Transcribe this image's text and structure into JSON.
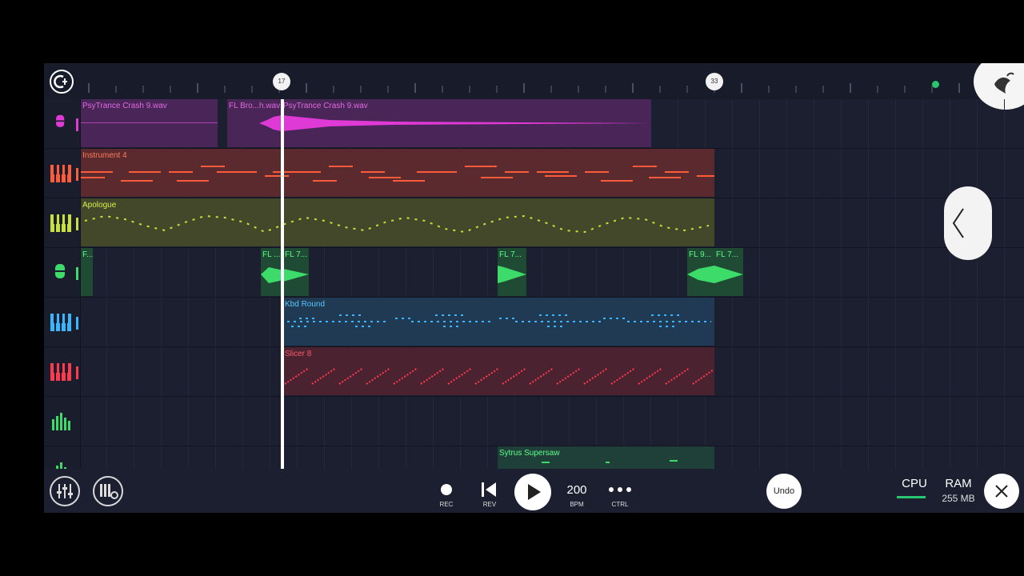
{
  "ruler": {
    "markers": [
      "17",
      "33"
    ]
  },
  "tracks": [
    {
      "id": "t1",
      "icon": "microphone-icon",
      "color": "#e03ad6",
      "clips": [
        {
          "label": "PsyTrance Crash 9.wav"
        },
        {
          "label": "FL Bro...h.wav"
        },
        {
          "label": "PsyTrance Crash 9.wav"
        }
      ]
    },
    {
      "id": "t2",
      "icon": "piano-icon",
      "color": "#ff5a3a",
      "clips": [
        {
          "label": "Instrument 4"
        }
      ]
    },
    {
      "id": "t3",
      "icon": "piano-icon",
      "color": "#c7e03a",
      "clips": [
        {
          "label": "Apologue"
        }
      ]
    },
    {
      "id": "t4",
      "icon": "microphone-icon",
      "color": "#3ddc6a",
      "clips": [
        {
          "label": "F..."
        },
        {
          "label": "FL ..."
        },
        {
          "label": "FL 7..."
        },
        {
          "label": "FL 7..."
        },
        {
          "label": "FL 9..."
        },
        {
          "label": "FL 7..."
        }
      ]
    },
    {
      "id": "t5",
      "icon": "piano-icon",
      "color": "#3ab6ff",
      "clips": [
        {
          "label": "Kbd Round"
        }
      ]
    },
    {
      "id": "t6",
      "icon": "piano-icon",
      "color": "#ff3a4f",
      "clips": [
        {
          "label": "Slicer 8"
        }
      ]
    },
    {
      "id": "t7",
      "icon": "automation-icon",
      "color": "#3ddc6a",
      "clips": []
    },
    {
      "id": "t8",
      "icon": "automation-icon",
      "color": "#3ddc6a",
      "clips": [
        {
          "label": "Sytrus Supersaw"
        }
      ]
    }
  ],
  "toolbar": {
    "rec_label": "REC",
    "rev_label": "REV",
    "bpm_value": "200",
    "bpm_label": "BPM",
    "ctrl_label": "CTRL",
    "undo_label": "Undo",
    "cpu_label": "CPU",
    "ram_label": "RAM",
    "ram_value": "255 MB"
  }
}
